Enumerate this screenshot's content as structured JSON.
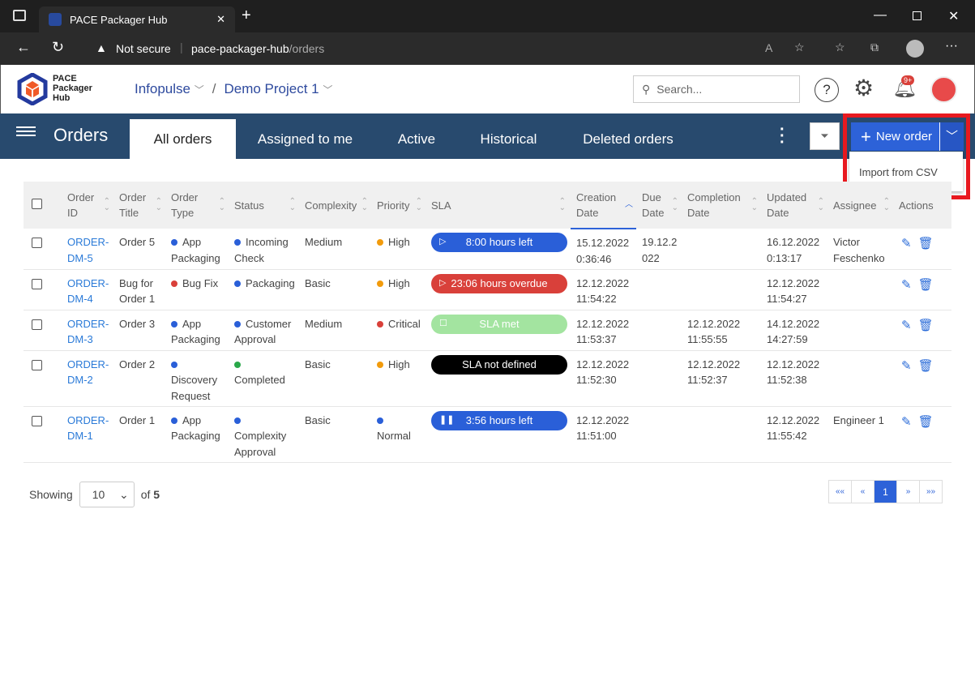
{
  "browser": {
    "tab_title": "PACE Packager Hub",
    "security": "Not secure",
    "url_host": "pace-packager-hub",
    "url_path": "/orders"
  },
  "header": {
    "logo_text": "PACE Packager Hub",
    "logo_lines": [
      "PACE",
      "Packager",
      "Hub"
    ],
    "breadcrumb": [
      "Infopulse",
      "Demo Project 1"
    ],
    "search_placeholder": "Search...",
    "notification_badge": "9+"
  },
  "nav": {
    "title": "Orders",
    "tabs": [
      "All orders",
      "Assigned to me",
      "Active",
      "Historical",
      "Deleted orders"
    ],
    "active_tab": "All orders",
    "new_order": "New order",
    "dropdown": [
      "Import from CSV"
    ]
  },
  "table": {
    "columns": [
      [
        "Order",
        "ID"
      ],
      [
        "Order",
        "Title"
      ],
      [
        "Order",
        "Type"
      ],
      [
        "Status"
      ],
      [
        "Complexity"
      ],
      [
        "Priority"
      ],
      [
        "SLA"
      ],
      [
        "Creation",
        "Date"
      ],
      [
        "Due",
        "Date"
      ],
      [
        "Completion",
        "Date"
      ],
      [
        "Updated",
        "Date"
      ],
      [
        "Assignee"
      ],
      [
        "Actions"
      ]
    ],
    "sorted_column": "Creation Date",
    "sort_direction": "ascending",
    "rows": [
      {
        "id": [
          "ORDER-",
          "DM-5"
        ],
        "title": [
          "Order 5"
        ],
        "type": [
          "App",
          "Packaging"
        ],
        "type_color": "#2a5fd8",
        "status": [
          "Incoming",
          "Check"
        ],
        "status_color": "#2a5fd8",
        "complexity": "Medium",
        "priority": "High",
        "priority_color": "#f29b0c",
        "sla": "8:00 hours left",
        "sla_icon": "play",
        "sla_color": "#2a5fd8",
        "sla_text_color": "#ffffff",
        "created": [
          "15.12.2022",
          "0:36:46"
        ],
        "due": [
          "19.12.2",
          "022"
        ],
        "completed": [
          "",
          ""
        ],
        "updated": [
          "16.12.2022",
          "0:13:17"
        ],
        "assignee": [
          "Victor",
          "Feschenko"
        ]
      },
      {
        "id": [
          "ORDER-",
          "DM-4"
        ],
        "title": [
          "Bug for",
          "Order 1"
        ],
        "type": [
          "Bug Fix",
          ""
        ],
        "type_color": "#d9403a",
        "status": [
          "Packaging",
          ""
        ],
        "status_color": "#2a5fd8",
        "complexity": "Basic",
        "priority": "High",
        "priority_color": "#f29b0c",
        "sla": "23:06 hours overdue",
        "sla_icon": "play",
        "sla_color": "#d9403a",
        "sla_text_color": "#ffffff",
        "created": [
          "12.12.2022",
          "11:54:22"
        ],
        "due": [
          "",
          ""
        ],
        "completed": [
          "",
          ""
        ],
        "updated": [
          "12.12.2022",
          "11:54:27"
        ],
        "assignee": [
          "",
          ""
        ]
      },
      {
        "id": [
          "ORDER-",
          "DM-3"
        ],
        "title": [
          "Order 3"
        ],
        "type": [
          "App",
          "Packaging"
        ],
        "type_color": "#2a5fd8",
        "status": [
          "Customer",
          "Approval"
        ],
        "status_color": "#2a5fd8",
        "complexity": "Medium",
        "priority": "Critical",
        "priority_color": "#d9403a",
        "sla": "SLA met",
        "sla_icon": "stop",
        "sla_color": "#a3e4a0",
        "sla_text_color": "#ffffff",
        "created": [
          "12.12.2022",
          "11:53:37"
        ],
        "due": [
          "",
          ""
        ],
        "completed": [
          "12.12.2022",
          "11:55:55"
        ],
        "updated": [
          "14.12.2022",
          "14:27:59"
        ],
        "assignee": [
          "",
          ""
        ]
      },
      {
        "id": [
          "ORDER-",
          "DM-2"
        ],
        "title": [
          "Order 2"
        ],
        "type": [
          "",
          "Discovery",
          "Request"
        ],
        "type_color": "#2a5fd8",
        "status": [
          "",
          "Completed"
        ],
        "status_color": "#2aa84a",
        "complexity": "Basic",
        "priority": "High",
        "priority_color": "#f29b0c",
        "sla": "SLA not defined",
        "sla_icon": "",
        "sla_color": "#000000",
        "sla_text_color": "#ffffff",
        "created": [
          "12.12.2022",
          "11:52:30"
        ],
        "due": [
          "",
          ""
        ],
        "completed": [
          "12.12.2022",
          "11:52:37"
        ],
        "updated": [
          "12.12.2022",
          "11:52:38"
        ],
        "assignee": [
          "",
          ""
        ]
      },
      {
        "id": [
          "ORDER-",
          "DM-1"
        ],
        "title": [
          "Order 1"
        ],
        "type": [
          "App",
          "Packaging"
        ],
        "type_color": "#2a5fd8",
        "status": [
          "",
          "Complexity",
          "Approval"
        ],
        "status_color": "#2a5fd8",
        "complexity": "Basic",
        "priority": "Normal",
        "priority_color": "#2a5fd8",
        "sla": "3:56 hours left",
        "sla_icon": "pause",
        "sla_color": "#2a5fd8",
        "sla_text_color": "#ffffff",
        "created": [
          "12.12.2022",
          "11:51:00"
        ],
        "due": [
          "",
          ""
        ],
        "completed": [
          "",
          ""
        ],
        "updated": [
          "12.12.2022",
          "11:55:42"
        ],
        "assignee": [
          "Engineer 1",
          ""
        ]
      }
    ]
  },
  "footer": {
    "showing": "Showing",
    "page_size": "10",
    "of": "of",
    "total": "5",
    "pages": [
      "««",
      "«",
      "1",
      "»",
      "»»"
    ],
    "current_page": "1"
  }
}
